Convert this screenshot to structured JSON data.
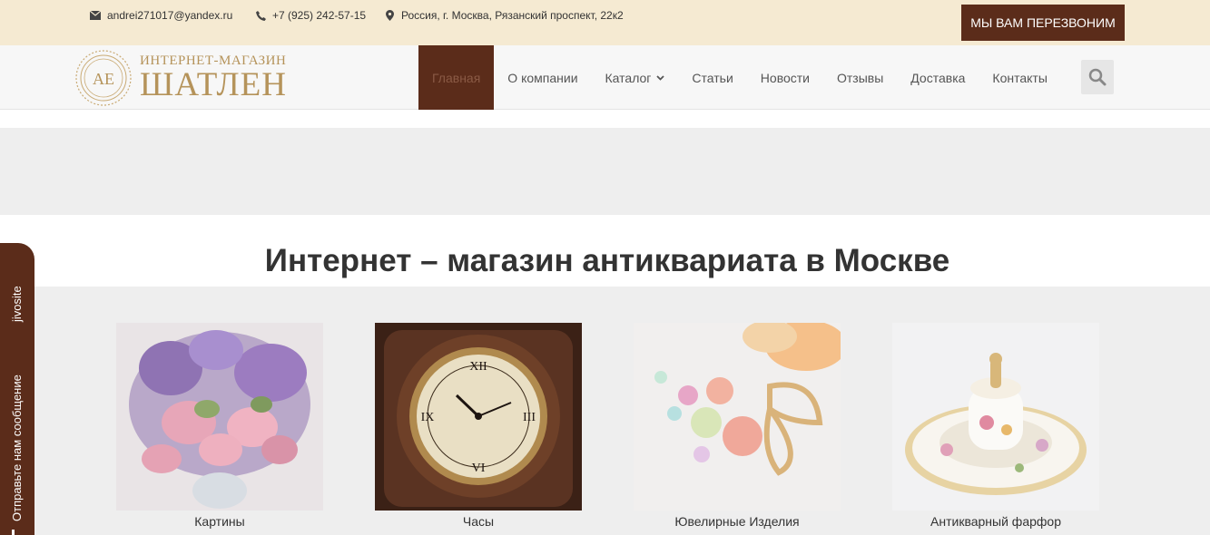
{
  "topbar": {
    "email": "andrei271017@yandex.ru",
    "phone": "+7 (925) 242-57-15",
    "address": "Россия, г. Москва, Рязанский проспект, 22к2",
    "callback_label": "МЫ ВАМ ПЕРЕЗВОНИМ",
    "icons": {
      "email": "envelope-icon",
      "phone": "phone-icon",
      "address": "map-marker-icon"
    }
  },
  "logo": {
    "monogram": "АЕ",
    "subtitle": "ИНТЕРНЕТ-МАГАЗИН",
    "title": "ШАТЛЕН"
  },
  "nav": {
    "items": [
      {
        "label": "Главная",
        "active": true
      },
      {
        "label": "О компании",
        "active": false
      },
      {
        "label": "Каталог",
        "active": false,
        "has_dropdown": true
      },
      {
        "label": "Статьи",
        "active": false
      },
      {
        "label": "Новости",
        "active": false
      },
      {
        "label": "Отзывы",
        "active": false
      },
      {
        "label": "Доставка",
        "active": false
      },
      {
        "label": "Контакты",
        "active": false
      }
    ],
    "search_icon": "search-icon"
  },
  "main": {
    "headline": "Интернет – магазин антиквариата в Москве",
    "categories": [
      {
        "label": "Картины",
        "image": "flowers-painting"
      },
      {
        "label": "Часы",
        "image": "antique-clock"
      },
      {
        "label": "Ювелирные Изделия",
        "image": "jewelry-brooch"
      },
      {
        "label": "Антикварный фарфор",
        "image": "porcelain-cup"
      }
    ]
  },
  "jivo": {
    "brand": "jivosite",
    "message": "Отправьте нам сообщение"
  },
  "colors": {
    "topbar_bg": "#f5ead2",
    "accent": "#5b2c1a",
    "logo_gold": "#b5935a",
    "band_gray": "#eeeeee"
  }
}
